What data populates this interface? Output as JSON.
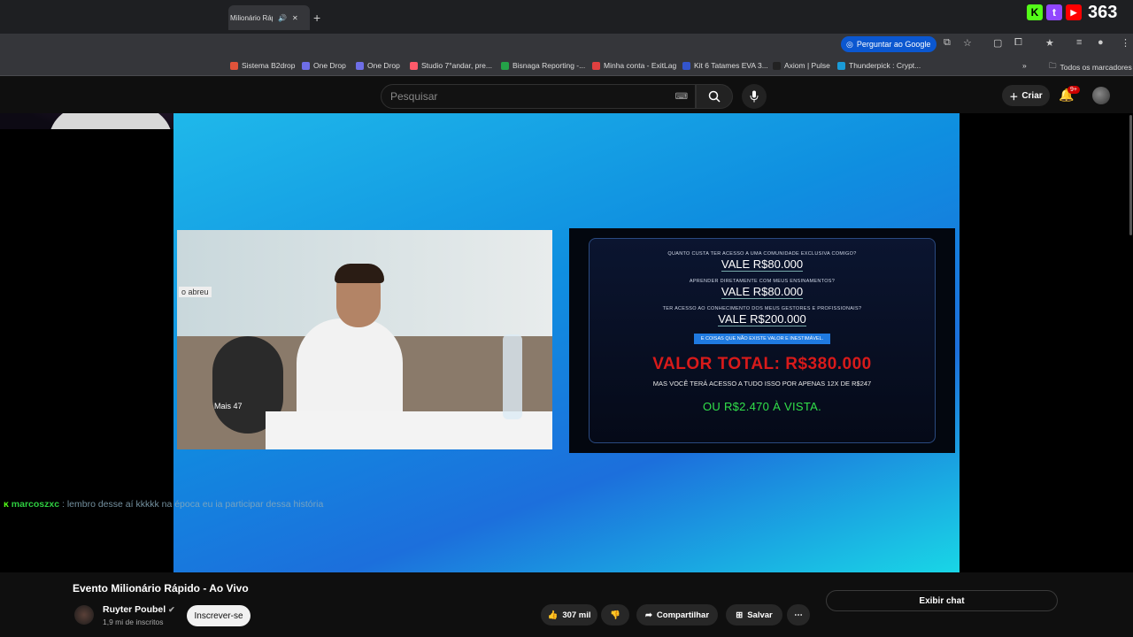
{
  "browser": {
    "tab_title": "Milionário Rápido",
    "ask_google": "Perguntar ao Google",
    "bookmarks": [
      {
        "label": "Sistema B2drop",
        "color": "#e0533a"
      },
      {
        "label": "One Drop",
        "color": "#6e6ee6"
      },
      {
        "label": "One Drop",
        "color": "#6e6ee6"
      },
      {
        "label": "Studio 7°andar, pre...",
        "color": "#ff5a6a"
      },
      {
        "label": "Bisnaga Reporting -...",
        "color": "#24a148"
      },
      {
        "label": "Minha conta - ExitLag",
        "color": "#e04040"
      },
      {
        "label": "Kit 6 Tatames EVA 3...",
        "color": "#3355cc"
      },
      {
        "label": "Axiom | Pulse",
        "color": "#222222"
      },
      {
        "label": "Thunderpick : Crypt...",
        "color": "#1a9bd8"
      }
    ],
    "all_bookmarks": "Todos os marcadores"
  },
  "stream_overlay": {
    "viewers": "363"
  },
  "youtube": {
    "search_placeholder": "Pesquisar",
    "create_label": "Criar",
    "notif_badge": "9+",
    "video_title": "Evento Milionário Rápido - Ao Vivo",
    "channel_name": "Ruyter Poubel",
    "subscribers": "1,9 mi de inscritos",
    "subscribe_label": "Inscrever-se",
    "likes": "307 mil",
    "share_label": "Compartilhar",
    "save_label": "Salvar",
    "chat_label": "Exibir chat"
  },
  "slide": {
    "q1": "QUANTO CUSTA TER ACESSO A UMA COMUNIDADE EXCLUSIVA COMIGO?",
    "v1": "VALE R$80.000",
    "q2": "APRENDER DIRETAMENTE COM MEUS ENSINAMENTOS?",
    "v2": "VALE R$80.000",
    "q3": "TER ACESSO AO CONHECIMENTO DOS MEUS GESTORES E PROFISSIONAIS?",
    "v3": "VALE R$200.000",
    "note": "E COISAS QUE NÃO EXISTE VALOR E INESTIMÁVEL.",
    "total": "VALOR TOTAL: R$380.000",
    "offer": "MAS VOCÊ TERÁ ACESSO A TUDO ISSO POR APENAS 12X DE R$247",
    "cash": "OU R$2.470 À VISTA."
  },
  "scene": {
    "label_left": "o abreu",
    "label_bottom": "Mais 47"
  },
  "chat_message": {
    "user": "marcoszxc",
    "text": ": lembro desse aí kkkkk na época eu ia participar dessa história"
  }
}
